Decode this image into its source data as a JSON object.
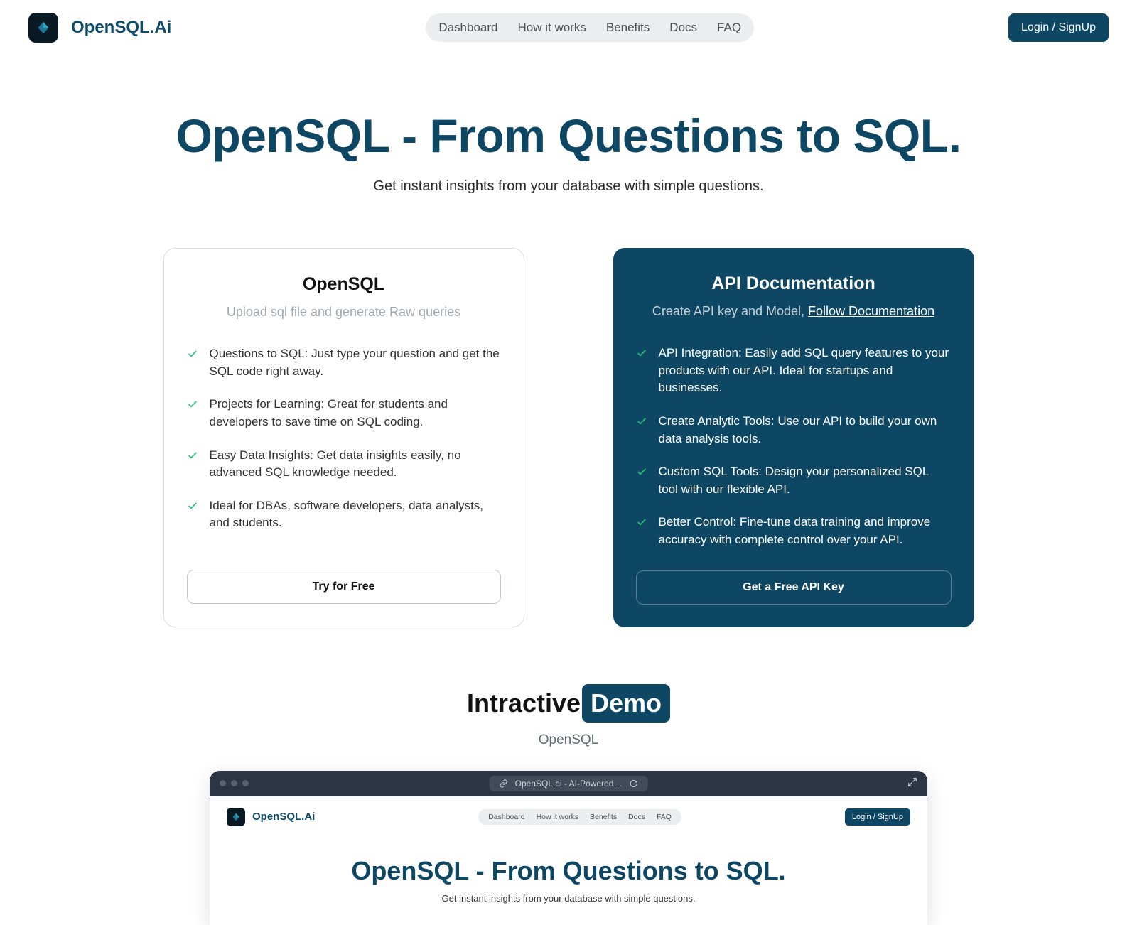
{
  "brand": "OpenSQL.Ai",
  "nav": {
    "items": [
      "Dashboard",
      "How it works",
      "Benefits",
      "Docs",
      "FAQ"
    ]
  },
  "login_label": "Login / SignUp",
  "hero": {
    "title": "OpenSQL - From Questions to SQL.",
    "subtitle": "Get instant insights from your database with simple questions."
  },
  "card_left": {
    "title": "OpenSQL",
    "subtitle": "Upload sql file and generate Raw queries",
    "features": [
      "Questions to SQL: Just type your question and get the SQL code right away.",
      "Projects for Learning: Great for students and developers to save time on SQL coding.",
      "Easy Data Insights: Get data insights easily, no advanced SQL knowledge needed.",
      "Ideal for DBAs, software developers, data analysts, and students."
    ],
    "cta": "Try for Free"
  },
  "card_right": {
    "title": "API Documentation",
    "subtitle_prefix": "Create API key and Model, ",
    "subtitle_link": "Follow Documentation",
    "features": [
      "API Integration: Easily add SQL query features to your products with our API. Ideal for startups and businesses.",
      "Create Analytic Tools: Use our API to build your own data analysis tools.",
      "Custom SQL Tools: Design your personalized SQL tool with our flexible API.",
      "Better Control: Fine-tune data training and improve accuracy with complete control over your API."
    ],
    "cta": "Get a Free API Key"
  },
  "demo": {
    "heading_a": "Intractive",
    "heading_b": "Demo",
    "sub": "OpenSQL"
  },
  "browser": {
    "addr": "OpenSQL.ai - AI-Powered…",
    "brand": "OpenSQL.Ai",
    "nav": [
      "Dashboard",
      "How it works",
      "Benefits",
      "Docs",
      "FAQ"
    ],
    "login": "Login / SignUp",
    "hero_title": "OpenSQL - From Questions to SQL.",
    "hero_sub": "Get instant insights from your database with simple questions."
  }
}
